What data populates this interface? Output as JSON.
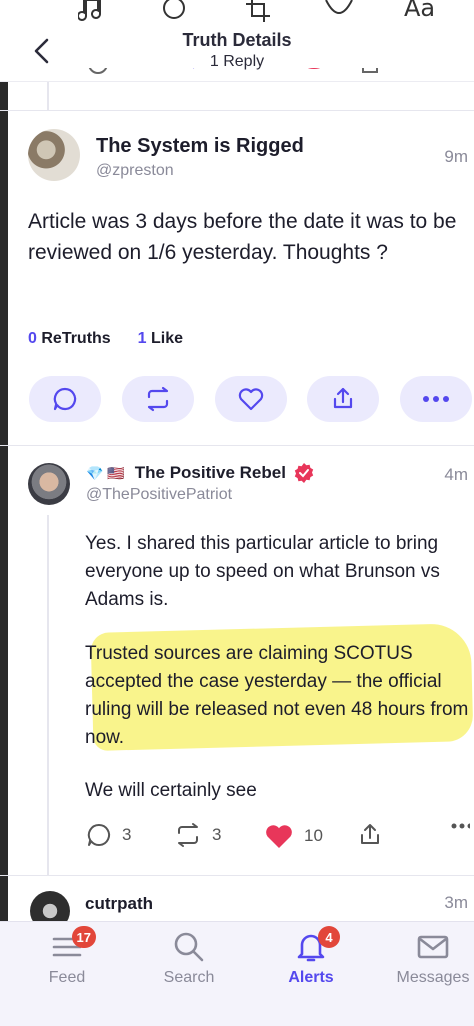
{
  "header": {
    "title": "Truth Details",
    "subtitle": "1 Reply"
  },
  "main_post": {
    "author_name": "The System is Rigged",
    "handle": "@zpreston",
    "time": "9m",
    "text": "Article was 3 days before the date it was to be reviewed on 1/6 yesterday. Thoughts ?",
    "retruths_count": "0",
    "retruths_label": "ReTruths",
    "likes_count": "1",
    "likes_label": "Like"
  },
  "reply": {
    "badges": "💎 🇺🇸",
    "author_name": "The Positive Rebel",
    "handle": "@ThePositivePatriot",
    "time": "4m",
    "paragraphs": [
      "Yes. I shared this particular article to bring everyone up to speed on what Brunson vs Adams is.",
      "Trusted sources are claiming SCOTUS accepted the case yesterday — the official ruling will be released not even 48 hours from now.",
      "We will certainly see"
    ],
    "reply_count": "3",
    "retruth_count": "3",
    "like_count": "10"
  },
  "next_reply": {
    "author_name": "cutrpath",
    "time": "3m"
  },
  "tabbar": {
    "tabs": [
      {
        "label": "Feed",
        "badge": "17"
      },
      {
        "label": "Search",
        "badge": ""
      },
      {
        "label": "Alerts",
        "badge": "4"
      },
      {
        "label": "Messages",
        "badge": ""
      }
    ]
  },
  "colors": {
    "accent": "#5448ee",
    "pill_bg": "#ebeafd",
    "like_red": "#e8365a",
    "badge_red": "#e2463a",
    "highlight": "#f7f066"
  }
}
